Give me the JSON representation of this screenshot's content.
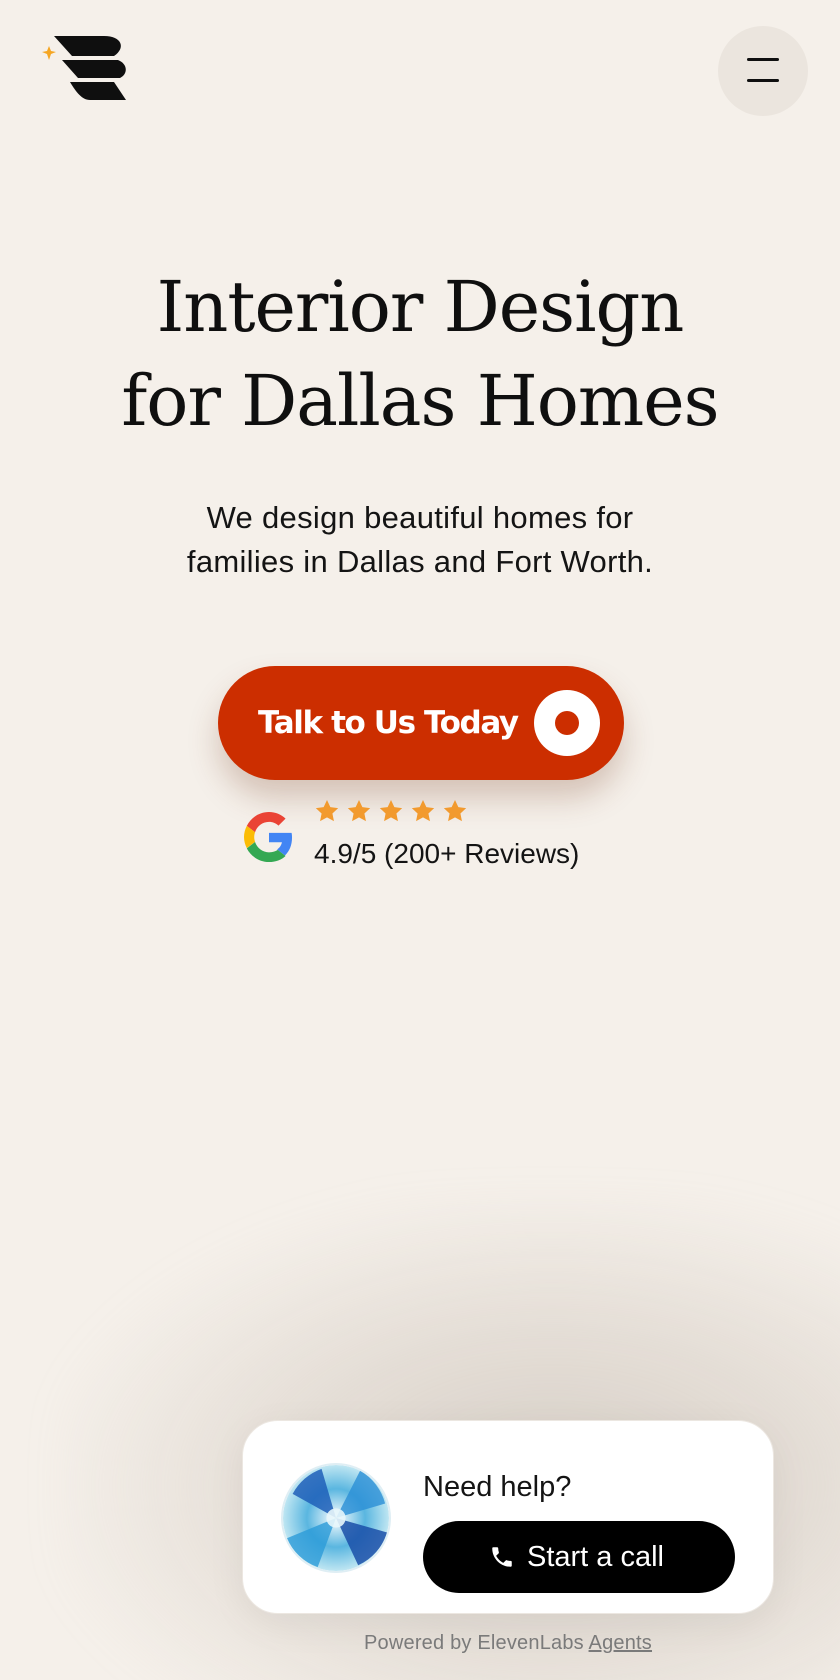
{
  "header": {
    "logo_icon": "brand-logo-with-sparkle",
    "menu_icon": "hamburger-menu-icon"
  },
  "hero": {
    "title_line1": "Interior Design",
    "title_line2": "for Dallas Homes",
    "subtitle_line1": "We design beautiful homes for",
    "subtitle_line2": "families in Dallas and Fort Worth."
  },
  "cta": {
    "label": "Talk to Us Today",
    "color": "#cc2e00"
  },
  "reviews": {
    "source_icon": "google-icon",
    "stars": 5,
    "star_color": "#f29a2e",
    "text": "4.9/5 (200+ Reviews)"
  },
  "widget": {
    "help_text": "Need help?",
    "call_label": "Start a call",
    "call_icon": "phone-icon",
    "powered_prefix": "Powered by ElevenLabs",
    "powered_link": "Agents"
  },
  "colors": {
    "background": "#f5f0ea",
    "accent": "#cc2e00",
    "dark": "#000000"
  }
}
